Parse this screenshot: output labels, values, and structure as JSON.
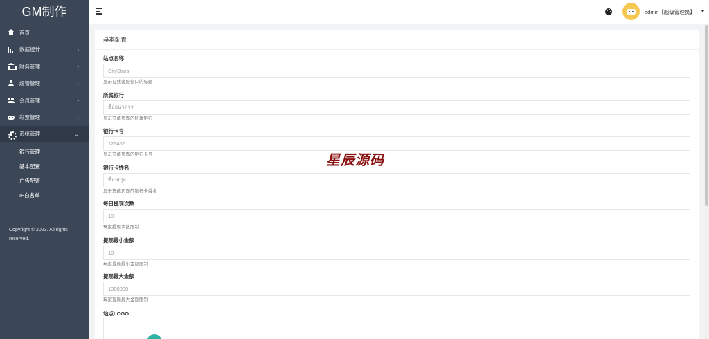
{
  "app": {
    "logo": "GM制作"
  },
  "sidebar": {
    "items": [
      {
        "label": "首页",
        "icon": "home-icon",
        "has_arrow": false,
        "arrow": ""
      },
      {
        "label": "数据统计",
        "icon": "bar-chart-icon",
        "has_arrow": true,
        "arrow": "›"
      },
      {
        "label": "财务管理",
        "icon": "bank-icon",
        "has_arrow": true,
        "arrow": "›"
      },
      {
        "label": "超管管理",
        "icon": "user-icon",
        "has_arrow": true,
        "arrow": "›"
      },
      {
        "label": "会员管理",
        "icon": "users-icon",
        "has_arrow": true,
        "arrow": "›"
      },
      {
        "label": "彩票管理",
        "icon": "gamepad-icon",
        "has_arrow": true,
        "arrow": "›"
      },
      {
        "label": "系统管理",
        "icon": "gear-icon",
        "has_arrow": true,
        "arrow": "⌄",
        "open": true
      }
    ],
    "submenu": [
      "银行管理",
      "基本配置",
      "广告配置",
      "IP白名单"
    ],
    "copyright": "Copyright © 2023. All rights reserved."
  },
  "header": {
    "menu_icon": "hamburger-menu-icon",
    "theme_icon": "palette-icon",
    "avatar_icon": "avatar-icon",
    "user": "admin【超级管理员】"
  },
  "main": {
    "title": "基本配置",
    "fields": [
      {
        "label": "站点名称",
        "value": "CityStars",
        "help": "显示在线客服窗口的标题"
      },
      {
        "label": "所属银行",
        "value": "ชื่อธนาคาร",
        "help": "显示充值页面的所属银行"
      },
      {
        "label": "银行卡号",
        "value": "123456",
        "help": "显示充值页面的银行卡号"
      },
      {
        "label": "银行卡姓名",
        "value": "ชื่อ-สกุล",
        "help": "显示充值页面的银行卡姓名"
      },
      {
        "label": "每日提现次数",
        "value": "10",
        "help": "玩家提现次数限制"
      },
      {
        "label": "提现最小金额",
        "value": "10",
        "help": "玩家提现最小金额限制"
      },
      {
        "label": "提现最大金额",
        "value": "1000000",
        "help": "玩家提现最大金额限制"
      }
    ],
    "logo_label": "站点LOGO"
  },
  "watermark": "星辰源码",
  "colors": {
    "sidebar_bg": "#3b4656",
    "avatar_bg": "#f6c851",
    "watermark": "#8a1010"
  }
}
